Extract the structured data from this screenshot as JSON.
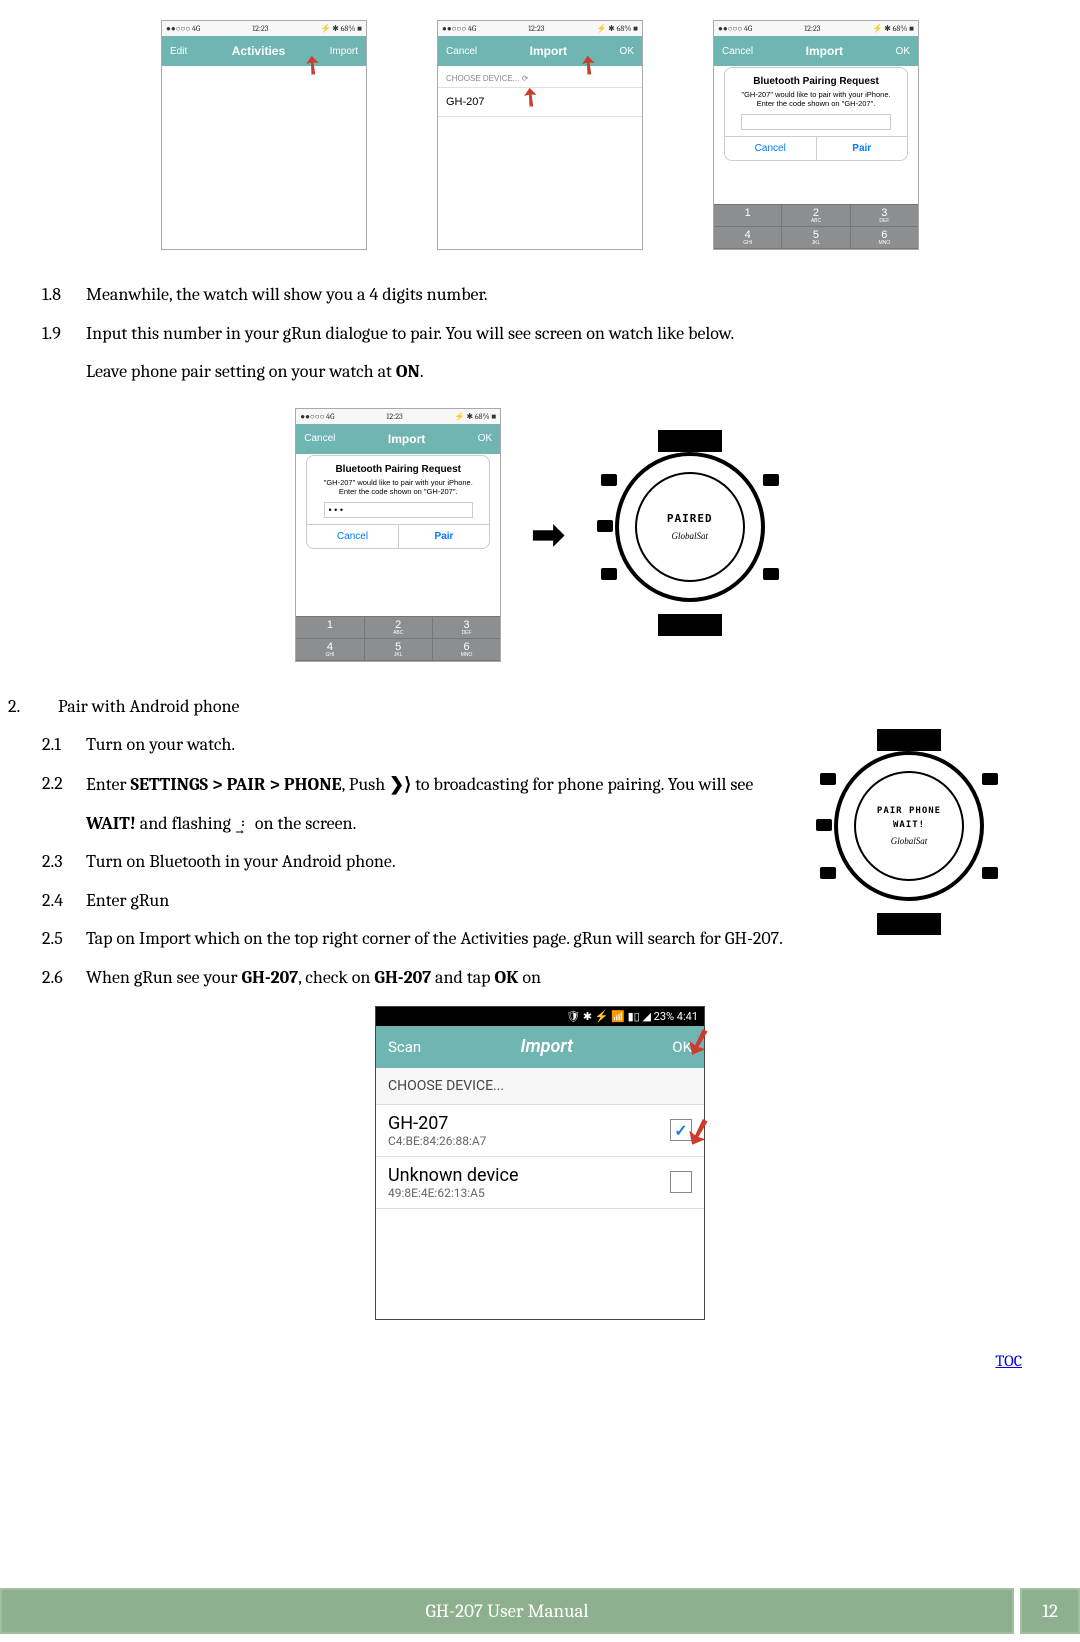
{
  "status": {
    "carrier": "●●○○○",
    "net": "4G",
    "time": "12:23",
    "battery": "⚡ ✱ 68% ■"
  },
  "activities_nav": {
    "left": "Edit",
    "title": "Activities",
    "right": "Import"
  },
  "import_nav": {
    "left": "Cancel",
    "title": "Import",
    "right": "OK"
  },
  "choose_label": "CHOOSE DEVICE... ⟳",
  "device_name": "GH-207",
  "pairing": {
    "title": "Bluetooth Pairing Request",
    "msg": "\"GH-207\" would like to pair with your iPhone. Enter the code shown on \"GH-207\".",
    "cancel": "Cancel",
    "pair": "Pair",
    "input_dots": "• • •"
  },
  "keypad": {
    "k1": "1",
    "k1s": "",
    "k2": "2",
    "k2s": "ABC",
    "k3": "3",
    "k3s": "DEF",
    "k4": "4",
    "k4s": "GHI",
    "k5": "5",
    "k5s": "JKL",
    "k6": "6",
    "k6s": "MNO"
  },
  "watch": {
    "paired": "PAIRED",
    "pair_phone": "PAIR PHONE",
    "wait": "WAIT!",
    "brand": "GlobalSat"
  },
  "arrow_big": "➡",
  "inst": {
    "n18": "1.8",
    "t18": "Meanwhile, the watch will show you a 4 digits number.",
    "n19": "1.9",
    "t19a": "Input this number in your gRun dialogue to pair. You will see screen on watch like below.",
    "t19b_a": "Leave phone pair setting on your watch at ",
    "t19b_b": "ON",
    "t19b_c": ".",
    "n2": "2.",
    "t2": "Pair with Android phone",
    "n21": "2.1",
    "t21": "Turn on your watch.",
    "n22": "2.2",
    "t22_a": "Enter ",
    "t22_b": "SETTINGS > PAIR > PHONE",
    "t22_c": ", Push ",
    "push_icon": "❯⟩",
    "t22_d": " to broadcasting for phone pairing. You will see",
    "t22_e": "WAIT!",
    "t22_f": " and flashing ",
    "bt_icon": "𝄈⃯",
    "t22_g": " on the screen.",
    "n23": "2.3",
    "t23": "Turn on Bluetooth in your Android phone.",
    "n24": "2.4",
    "t24": "Enter gRun",
    "n25": "2.5",
    "t25": "Tap on Import which on the top right corner of the Activities page. gRun will search for GH-207.",
    "n26": "2.6",
    "t26_a": "When gRun see your ",
    "t26_b": "GH-207",
    "t26_c": ", check on ",
    "t26_d": "GH-207",
    "t26_e": " and tap ",
    "t26_f": "OK",
    "t26_g": " on"
  },
  "android": {
    "status": "🛡  ✱ ⚡ 📶 ▮▯ ◢ 23%  4:41",
    "scan": "Scan",
    "import": "Import",
    "ok": "OK",
    "choose": "CHOOSE DEVICE...",
    "dev1_name": "GH-207",
    "dev1_mac": "C4:BE:84:26:88:A7",
    "dev2_name": "Unknown device",
    "dev2_mac": "49:8E:4E:62:13:A5",
    "check": "✓"
  },
  "footer": {
    "toc": "TOC",
    "title": "GH-207 User Manual",
    "page": "12"
  }
}
